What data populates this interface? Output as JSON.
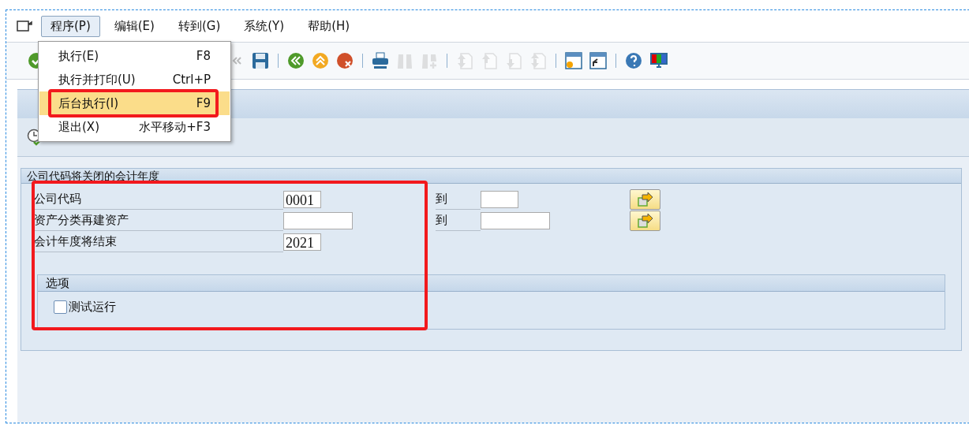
{
  "menubar": [
    {
      "label": "程序(P)",
      "selected": true
    },
    {
      "label": "编辑(E)",
      "selected": false
    },
    {
      "label": "转到(G)",
      "selected": false
    },
    {
      "label": "系统(Y)",
      "selected": false
    },
    {
      "label": "帮助(H)",
      "selected": false
    }
  ],
  "menu": [
    {
      "label": "执行(E)",
      "shortcut": "F8",
      "selected": false,
      "outlined": false
    },
    {
      "label": "执行并打印(U)",
      "shortcut": "Ctrl+P",
      "selected": false,
      "outlined": false
    },
    {
      "label": "后台执行(I)",
      "shortcut": "F9",
      "selected": true,
      "outlined": true
    },
    {
      "label": "退出(X)",
      "shortcut": "水平移动+F3",
      "selected": false,
      "outlined": false
    }
  ],
  "toolbar": [
    {
      "kind": "ok",
      "disabled": false
    },
    {
      "kind": "collapse",
      "disabled": true
    },
    {
      "kind": "save",
      "disabled": false
    },
    {
      "kind": "sep"
    },
    {
      "kind": "back",
      "disabled": false
    },
    {
      "kind": "exit",
      "disabled": false
    },
    {
      "kind": "cancel",
      "disabled": false
    },
    {
      "kind": "sep"
    },
    {
      "kind": "print",
      "disabled": false
    },
    {
      "kind": "find",
      "disabled": true
    },
    {
      "kind": "find-next",
      "disabled": true
    },
    {
      "kind": "sep"
    },
    {
      "kind": "first-page",
      "disabled": true
    },
    {
      "kind": "prev-page",
      "disabled": true
    },
    {
      "kind": "next-page",
      "disabled": true
    },
    {
      "kind": "last-page",
      "disabled": true
    },
    {
      "kind": "sep"
    },
    {
      "kind": "new-session",
      "disabled": false
    },
    {
      "kind": "shortcut",
      "disabled": false
    },
    {
      "kind": "sep"
    },
    {
      "kind": "help",
      "disabled": false
    },
    {
      "kind": "layout",
      "disabled": false
    }
  ],
  "app_toolbar": [
    {
      "kind": "execute"
    }
  ],
  "selection": {
    "title": "公司代码将关闭的会计年度",
    "outlined": true,
    "rows": [
      {
        "label": "公司代码",
        "value": "0001",
        "to_label": "到",
        "to_value": ""
      },
      {
        "label": "资产分类再建资产",
        "value": "",
        "to_label": "到",
        "to_value": ""
      },
      {
        "label": "会计年度将结束",
        "value": "2021"
      }
    ]
  },
  "options": {
    "title": "选项",
    "checkbox": {
      "label": "测试运行",
      "checked": false
    }
  }
}
